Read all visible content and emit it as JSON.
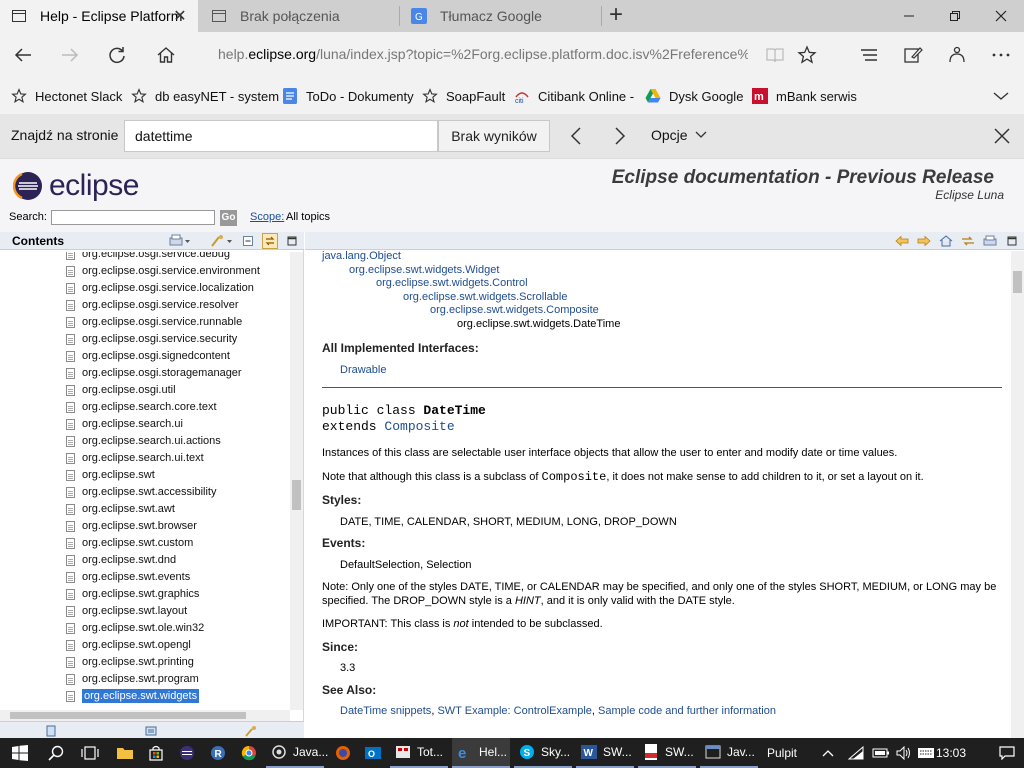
{
  "browser": {
    "tabs": [
      {
        "title": "Help - Eclipse Platform",
        "icon": "document-icon",
        "active": true
      },
      {
        "title": "Brak połączenia",
        "icon": "document-icon",
        "active": false
      },
      {
        "title": "Tłumacz Google",
        "icon": "google-translate-icon",
        "active": false
      }
    ],
    "url_prefix": "help.",
    "url_domain": "eclipse.org",
    "url_rest": "/luna/index.jsp?topic=%2Forg.eclipse.platform.doc.isv%2Freference%2Fapi%2"
  },
  "favorites": [
    {
      "label": "Hectonet Slack",
      "icon": "star-icon"
    },
    {
      "label": "db easyNET - system",
      "icon": "star-icon"
    },
    {
      "label": "ToDo - Dokumenty",
      "icon": "docs-icon"
    },
    {
      "label": "SoapFault",
      "icon": "star-icon"
    },
    {
      "label": "Citibank Online -",
      "icon": "citi-icon"
    },
    {
      "label": "Dysk Google",
      "icon": "drive-icon"
    },
    {
      "label": "mBank serwis",
      "icon": "mbank-icon"
    }
  ],
  "findbar": {
    "label": "Znajdź na stronie",
    "query": "datettime",
    "result": "Brak wyników",
    "options": "Opcje"
  },
  "eclipse_header": {
    "logo_text": "eclipse",
    "title": "Eclipse documentation - Previous Release",
    "subtitle": "Eclipse Luna",
    "search_label": "Search:",
    "go_label": "Go",
    "scope_label": "Scope:",
    "scope_value": "All topics"
  },
  "toc": {
    "title": "Contents",
    "items": [
      "org.eclipse.osgi.service.debug",
      "org.eclipse.osgi.service.environment",
      "org.eclipse.osgi.service.localization",
      "org.eclipse.osgi.service.resolver",
      "org.eclipse.osgi.service.runnable",
      "org.eclipse.osgi.service.security",
      "org.eclipse.osgi.signedcontent",
      "org.eclipse.osgi.storagemanager",
      "org.eclipse.osgi.util",
      "org.eclipse.search.core.text",
      "org.eclipse.search.ui",
      "org.eclipse.search.ui.actions",
      "org.eclipse.search.ui.text",
      "org.eclipse.swt",
      "org.eclipse.swt.accessibility",
      "org.eclipse.swt.awt",
      "org.eclipse.swt.browser",
      "org.eclipse.swt.custom",
      "org.eclipse.swt.dnd",
      "org.eclipse.swt.events",
      "org.eclipse.swt.graphics",
      "org.eclipse.swt.layout",
      "org.eclipse.swt.ole.win32",
      "org.eclipse.swt.opengl",
      "org.eclipse.swt.printing",
      "org.eclipse.swt.program",
      "org.eclipse.swt.widgets"
    ],
    "selected_index": 26
  },
  "doc": {
    "hierarchy": [
      "java.lang.Object",
      "org.eclipse.swt.widgets.Widget",
      "org.eclipse.swt.widgets.Control",
      "org.eclipse.swt.widgets.Scrollable",
      "org.eclipse.swt.widgets.Composite",
      "org.eclipse.swt.widgets.DateTime"
    ],
    "interfaces_heading": "All Implemented Interfaces:",
    "interface": "Drawable",
    "decl_prefix": "public class ",
    "decl_class": "DateTime",
    "extends_prefix": "extends ",
    "extends_class": "Composite",
    "desc1": "Instances of this class are selectable user interface objects that allow the user to enter and modify date or time values.",
    "desc2_a": "Note that although this class is a subclass of ",
    "desc2_code": "Composite",
    "desc2_b": ", it does not make sense to add children to it, or set a layout on it.",
    "styles_heading": "Styles:",
    "styles": "DATE, TIME, CALENDAR, SHORT, MEDIUM, LONG, DROP_DOWN",
    "events_heading": "Events:",
    "events": "DefaultSelection, Selection",
    "note_a": "Note: Only one of the styles DATE, TIME, or CALENDAR may be specified, and only one of the styles SHORT, MEDIUM, or LONG may be specified. The DROP_DOWN style is a ",
    "note_hint": "HINT",
    "note_b": ", and it is only valid with the DATE style.",
    "important_a": "IMPORTANT: This class is ",
    "important_not": "not",
    "important_b": " intended to be subclassed.",
    "since_heading": "Since:",
    "since": "3.3",
    "see_also_heading": "See Also:",
    "see_also": [
      "DateTime snippets",
      "SWT Example: ControlExample",
      "Sample code and further information"
    ]
  },
  "taskbar": {
    "items": [
      {
        "label": "Java...",
        "icon": "eclipse-icon"
      },
      {
        "label": "Tot...",
        "icon": "total-commander-icon"
      },
      {
        "label": "Hel...",
        "icon": "edge-icon"
      },
      {
        "label": "Sky...",
        "icon": "skype-icon"
      },
      {
        "label": "SW...",
        "icon": "word-icon"
      },
      {
        "label": "SW...",
        "icon": "pdf-icon"
      },
      {
        "label": "Jav...",
        "icon": "java-window-icon"
      }
    ],
    "desktop_label": "Pulpit",
    "time": "13:03"
  }
}
